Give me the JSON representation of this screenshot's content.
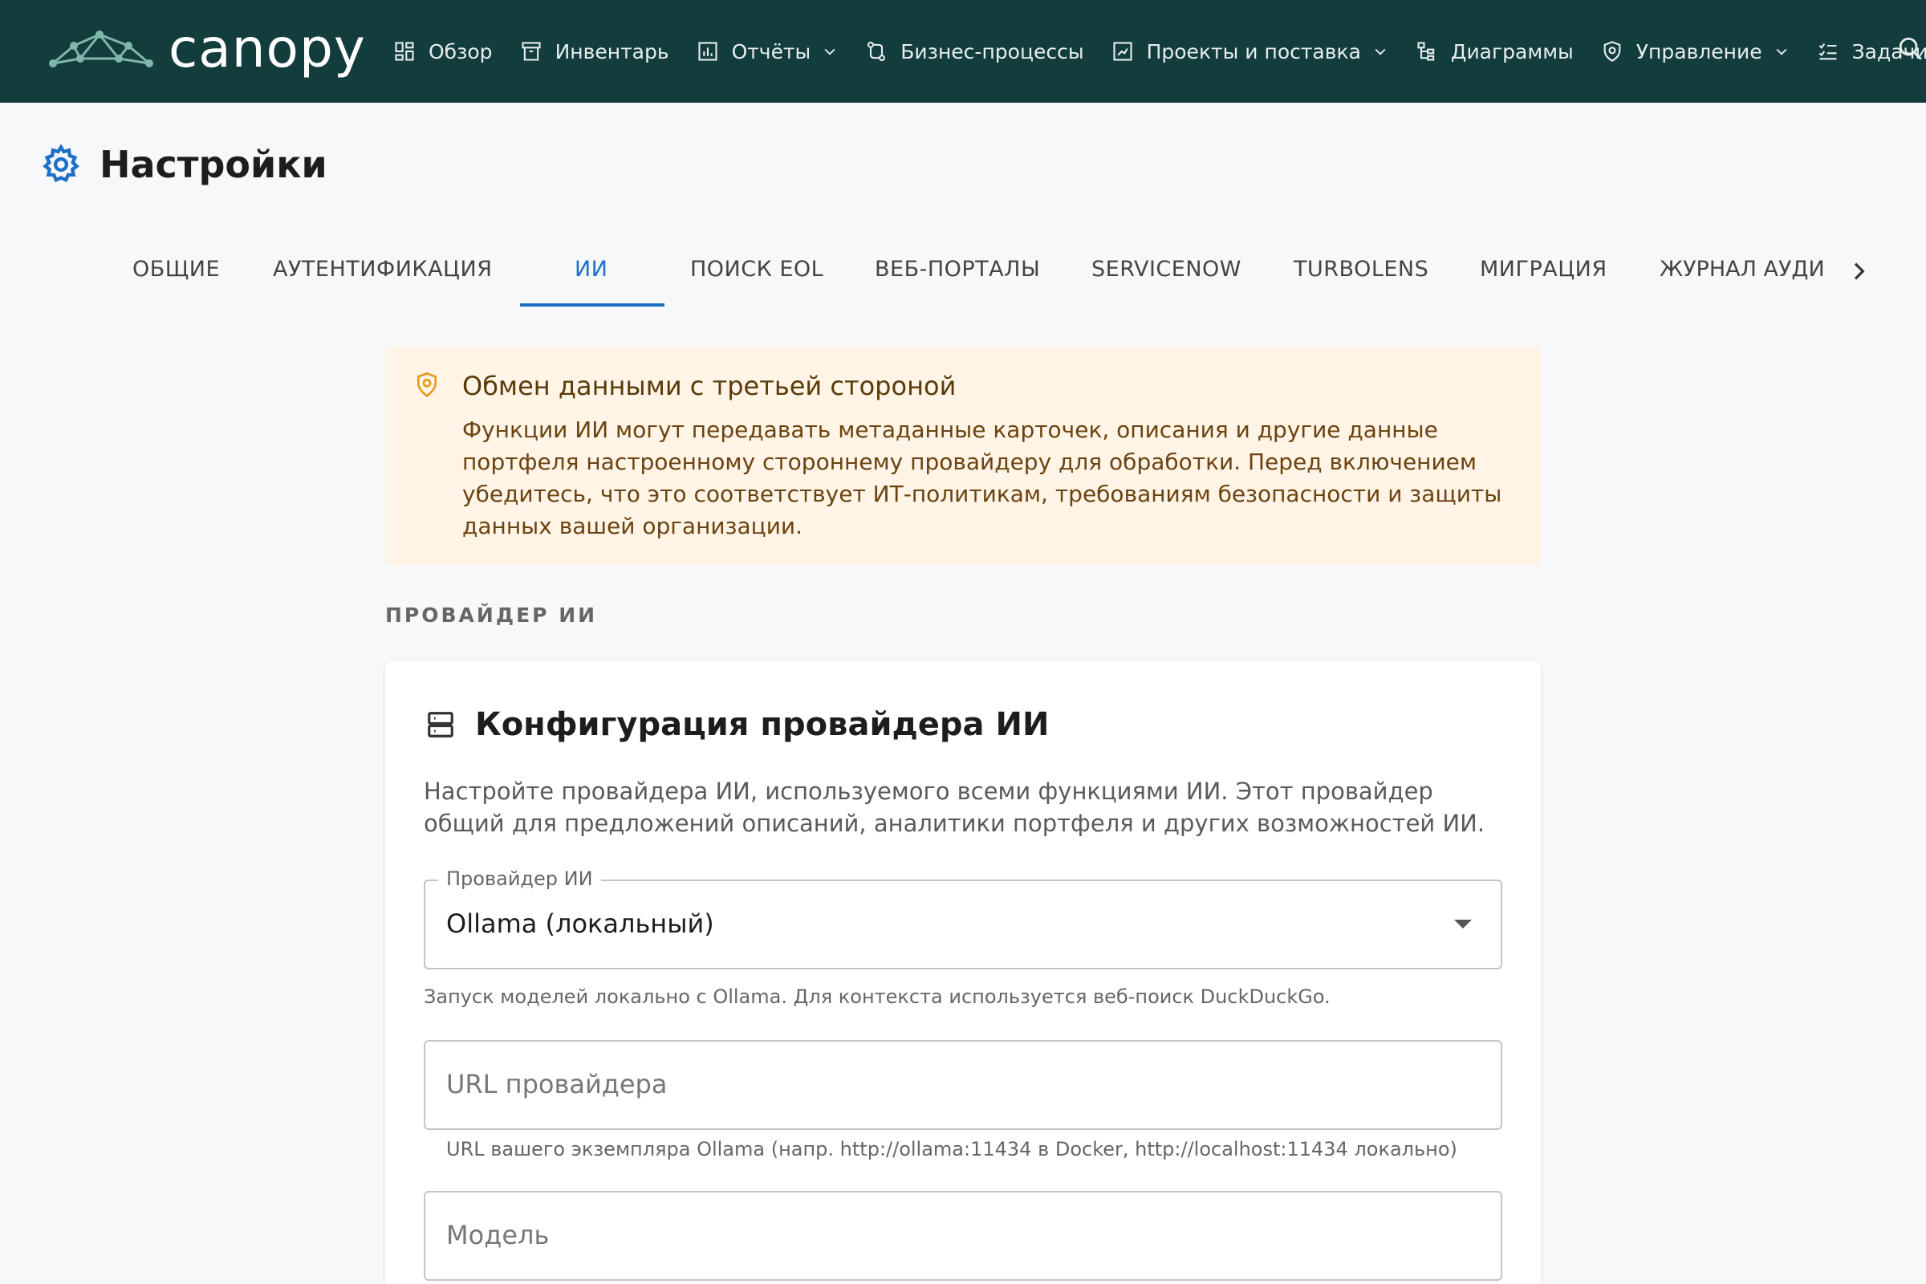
{
  "app": {
    "name": "canopy"
  },
  "nav": {
    "items": [
      {
        "label": "Обзор",
        "icon": "dashboard-icon"
      },
      {
        "label": "Инвентарь",
        "icon": "archive-icon"
      },
      {
        "label": "Отчёты",
        "icon": "report-icon",
        "dropdown": true
      },
      {
        "label": "Бизнес-процессы",
        "icon": "workflow-icon"
      },
      {
        "label": "Проекты и поставка",
        "icon": "project-icon",
        "dropdown": true
      },
      {
        "label": "Диаграммы",
        "icon": "diagram-icon"
      },
      {
        "label": "Управление",
        "icon": "shield-icon",
        "dropdown": true
      },
      {
        "label": "Задачи",
        "icon": "tasks-icon",
        "badge": true
      }
    ]
  },
  "page": {
    "title": "Настройки"
  },
  "tabs": [
    "ОБЩИЕ",
    "АУТЕНТИФИКАЦИЯ",
    "ИИ",
    "ПОИСК EOL",
    "ВЕБ-ПОРТАЛЫ",
    "SERVICENOW",
    "TURBOLENS",
    "МИГРАЦИЯ",
    "ЖУРНАЛ АУДИ"
  ],
  "active_tab": "ИИ",
  "banner": {
    "title": "Обмен данными с третьей стороной",
    "text": "Функции ИИ могут передавать метаданные карточек, описания и другие данные портфеля настроенному стороннему провайдеру для обработки. Перед включением убедитесь, что это соответствует ИТ-политикам, требованиям безопасности и защиты данных вашей организации."
  },
  "section_label": "ПРОВАЙДЕР ИИ",
  "card": {
    "title": "Конфигурация провайдера ИИ",
    "description": "Настройте провайдера ИИ, используемого всеми функциями ИИ. Этот провайдер общий для предложений описаний, аналитики портфеля и других возможностей ИИ.",
    "provider_field": {
      "label": "Провайдер ИИ",
      "value": "Ollama (локальный)",
      "helper": "Запуск моделей локально с Ollama. Для контекста используется веб-поиск DuckDuckGo."
    },
    "url_field": {
      "placeholder": "URL провайдера",
      "helper": "URL вашего экземпляра Ollama (напр. http://ollama:11434 в Docker, http://localhost:11434 локально)"
    },
    "model_field": {
      "placeholder": "Модель"
    }
  },
  "colors": {
    "topbar": "#123d3c",
    "accent": "#1e6fc7",
    "banner_bg": "#fff4e6",
    "badge": "#e53935"
  }
}
